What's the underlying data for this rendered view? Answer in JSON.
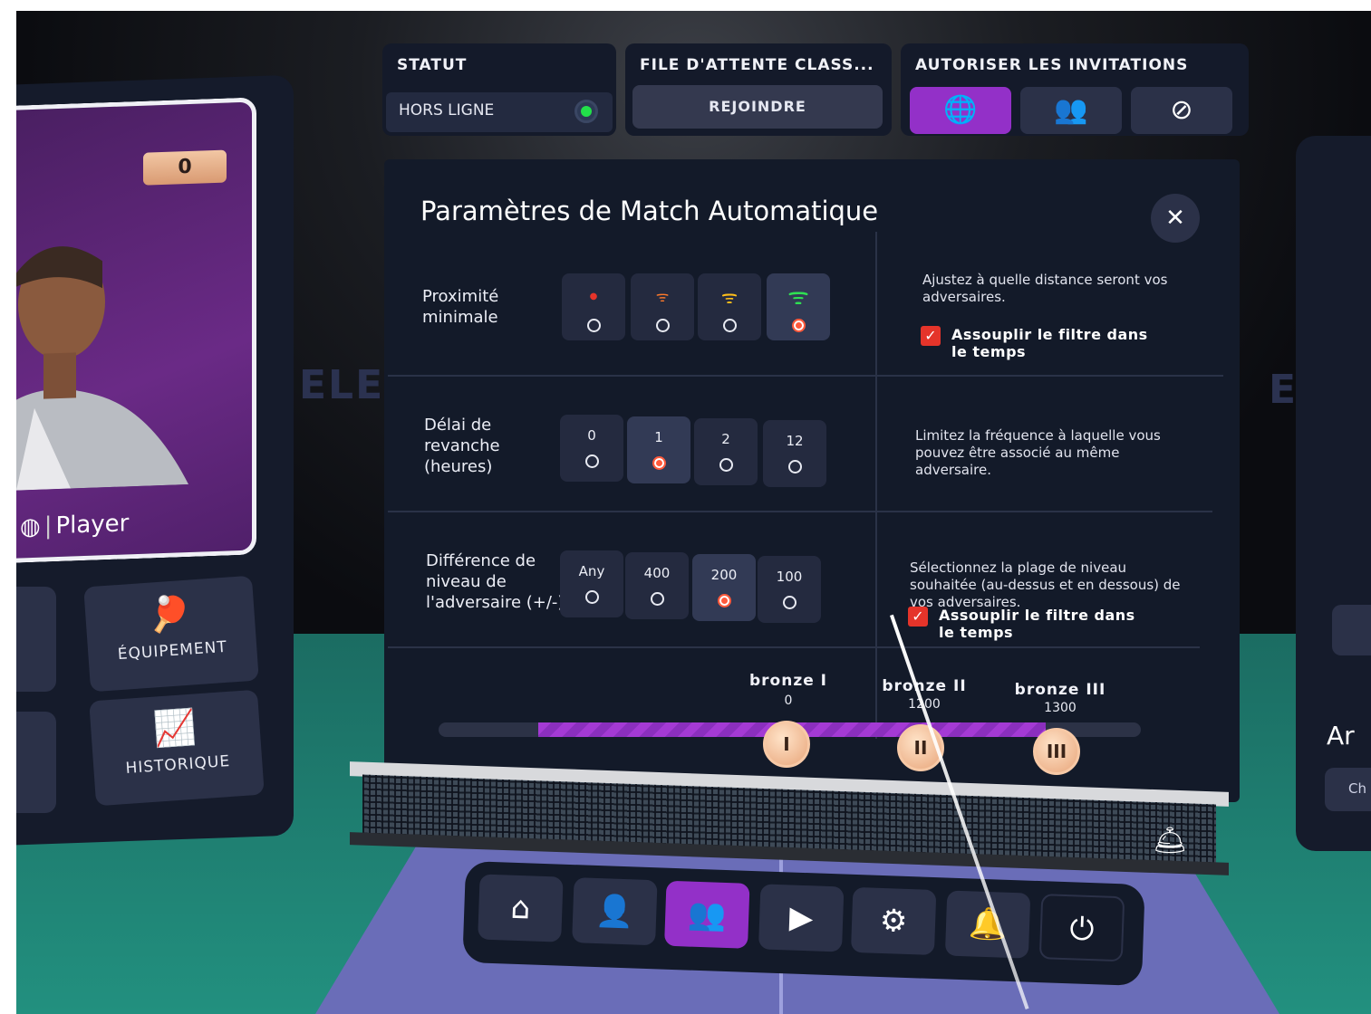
{
  "status": {
    "title": "STATUT",
    "value": "HORS LIGNE",
    "indicator_color": "#22e04a"
  },
  "ranked_queue": {
    "title": "FILE D'ATTENTE CLASS...",
    "join_label": "REJOINDRE"
  },
  "invitations": {
    "title": "AUTORISER LES INVITATIONS",
    "options": [
      {
        "icon": "globe-icon",
        "glyph": "🌐",
        "active": true
      },
      {
        "icon": "friends-icon",
        "glyph": "👥",
        "active": false
      },
      {
        "icon": "block-icon",
        "glyph": "⊘",
        "active": false
      }
    ]
  },
  "profile": {
    "badge_value": "0",
    "name": "Player",
    "buttons": {
      "equipment": "ÉQUIPEMENT",
      "history": "HISTORIQUE"
    }
  },
  "dialog": {
    "title": "Paramètres de Match Automatique",
    "close_glyph": "✕",
    "proximity": {
      "label_line1": "Proximité",
      "label_line2": "minimale",
      "selected_index": 3,
      "description": "Ajustez à quelle distance seront vos adversaires.",
      "relax_label_line1": "Assouplir le filtre dans",
      "relax_label_line2": "le temps",
      "relax_checked": true
    },
    "rematch": {
      "label_line1": "Délai de",
      "label_line2": "revanche",
      "label_line3": "(heures)",
      "options": [
        "0",
        "1",
        "2",
        "12"
      ],
      "selected_index": 1,
      "description": "Limitez la fréquence à laquelle vous pouvez être associé au même adversaire."
    },
    "level_diff": {
      "label_line1": "Différence de",
      "label_line2": "niveau de",
      "label_line3": "l'adversaire (+/-)",
      "options": [
        "Any",
        "400",
        "200",
        "100"
      ],
      "selected_index": 2,
      "description": "Sélectionnez la plage de niveau souhaitée (au-dessus et en dessous) de vos adversaires.",
      "relax_label_line1": "Assouplir le filtre dans",
      "relax_label_line2": "le temps",
      "relax_checked": true
    },
    "ranks": [
      {
        "name": "bronze I",
        "score": "0",
        "knob": "I"
      },
      {
        "name": "bronze II",
        "score": "1200",
        "knob": "II"
      },
      {
        "name": "bronze III",
        "score": "1300",
        "knob": "III"
      }
    ]
  },
  "right_panel": {
    "text": "Ar",
    "button_text": "Ch"
  },
  "nav": [
    {
      "icon": "home-icon",
      "glyph": "⌂"
    },
    {
      "icon": "profile-icon",
      "glyph": "👤"
    },
    {
      "icon": "social-icon",
      "glyph": "👥"
    },
    {
      "icon": "tutorial-icon",
      "glyph": "▶"
    },
    {
      "icon": "settings-icon",
      "glyph": "⚙"
    },
    {
      "icon": "notifications-icon",
      "glyph": "🔔"
    },
    {
      "icon": "power-icon",
      "glyph": "⏻"
    }
  ],
  "colors": {
    "accent": "#9330c8",
    "panel": "#131a29",
    "button": "#2b3148",
    "selected_radio": "#ff5a3c",
    "checkbox": "#e5342a",
    "floor": "#22907f"
  }
}
